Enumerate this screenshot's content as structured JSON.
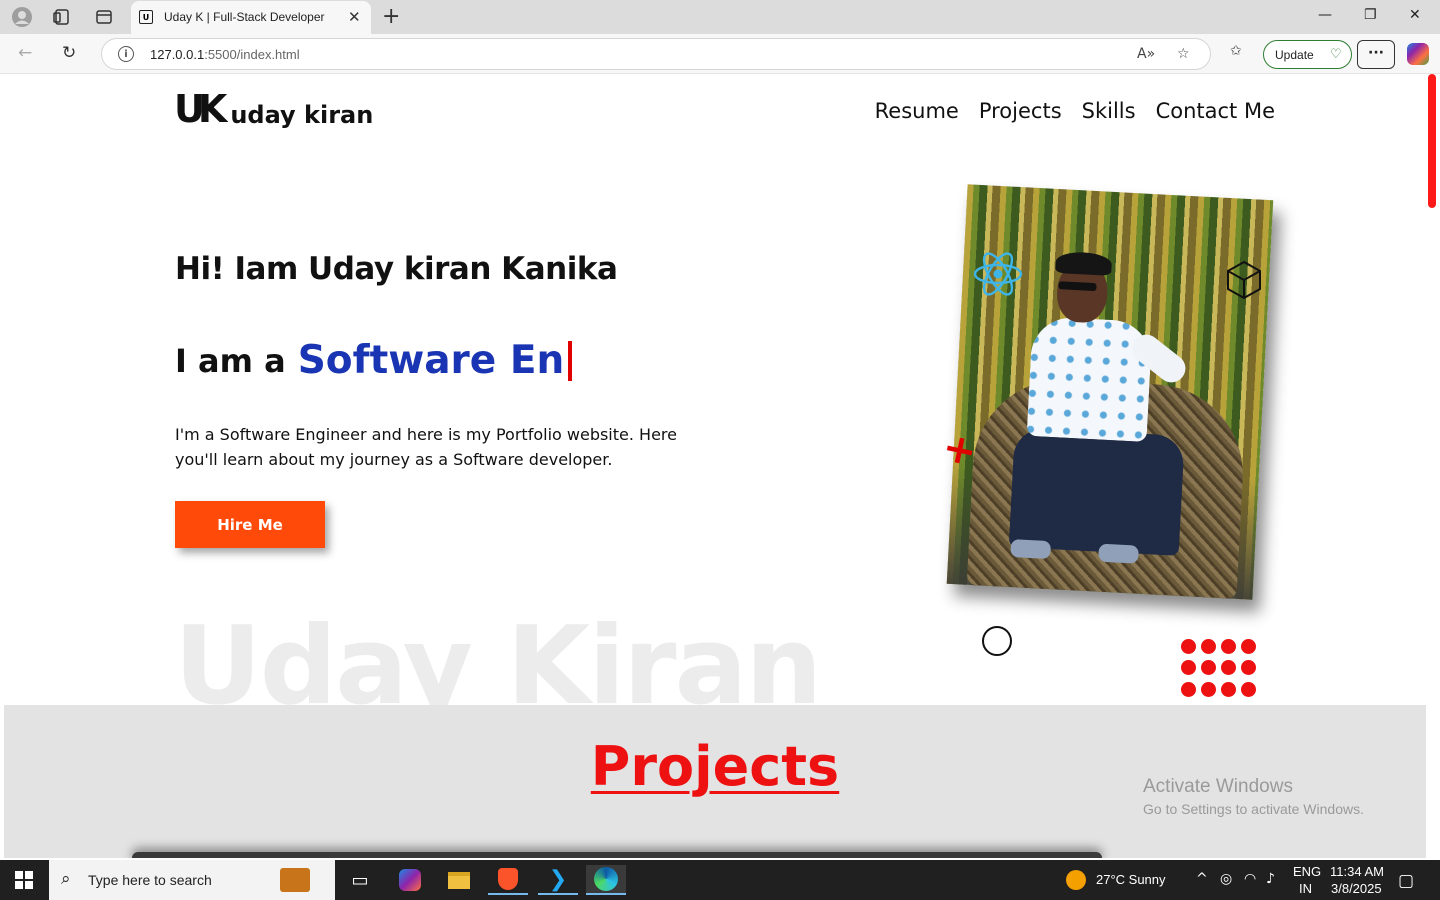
{
  "browser": {
    "tab_title": "Uday K | Full-Stack Developer",
    "url_host": "127.0.0.1",
    "url_path": ":5500/index.html",
    "update_label": "Update",
    "new_tab_icon": "plus-icon",
    "more_label": "···"
  },
  "site": {
    "logo_mark": "UK",
    "logo_text": "uday kiran",
    "nav": [
      "Resume",
      "Projects",
      "Skills",
      "Contact Me"
    ],
    "greeting": "Hi! Iam Uday kiran Kanika",
    "typed_prefix": "I am a",
    "typed_text": "Software En",
    "intro": "I'm a Software Engineer and here is my Portfolio website. Here you'll learn about my journey as a Software developer.",
    "hire_label": "Hire Me",
    "watermark_name": "Uday Kiran",
    "projects_heading": "Projects",
    "accent_red": "#ee1111",
    "accent_blue": "#1a35b3",
    "button_color": "#ff4a0a"
  },
  "windows_watermark": {
    "title": "Activate Windows",
    "subtitle": "Go to Settings to activate Windows."
  },
  "taskbar": {
    "search_placeholder": "Type here to search",
    "weather": "27°C  Sunny",
    "lang_top": "ENG",
    "lang_bottom": "IN",
    "time": "11:34 AM",
    "date": "3/8/2025"
  }
}
